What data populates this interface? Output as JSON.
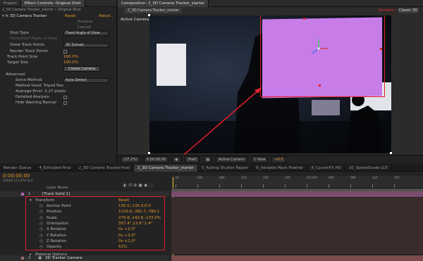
{
  "left_tabs": [
    "Project",
    "Effect Controls: Original Shot",
    "2_3D Camera Tracker_starter • Original Shot"
  ],
  "comp_tabs": [
    "Composition: 2_3D Camera Tracker_starter",
    "2_3D Camera Tracker_starter"
  ],
  "renderer": {
    "label": "Renderer:",
    "value": "Classic 3D"
  },
  "effect": {
    "name": "3D Camera Tracker",
    "reset": "Reset",
    "about": "About...",
    "analyze": "Analyze",
    "cancel": "Cancel",
    "shot_type_label": "Shot Type",
    "shot_type_value": "Fixed Angle of View",
    "hfov_label": "Horizontal Angle of View",
    "show_points_label": "Show Track Points",
    "show_points_value": "3D Solved",
    "render_points_label": "Render Track Points",
    "point_size_label": "Track Point Size",
    "point_size_value": "100.0%",
    "target_size_label": "Target Size",
    "target_size_value": "100.0%",
    "create_camera": "Create Camera",
    "advanced": "Advanced",
    "solve_method_label": "Solve Method",
    "solve_method_value": "Auto Detect",
    "method_used": "Method Used: Tripod Pan",
    "avg_error": "Average Error: 2.27 pixels",
    "detailed_analysis": "Detailed Analysis",
    "hide_warning": "Hide Warning Banner"
  },
  "viewer": {
    "label": "Active Camera",
    "zoom": "(37.2%)",
    "timecode": "0:00:00:00",
    "resolution": "(Half)",
    "camera": "Active Camera",
    "views": "1 View",
    "exposure": "+0.0"
  },
  "timeline_tabs": [
    "Render Queue",
    "4_Extruded-final",
    "2_3D Camera Tracker-final",
    "2_3D Camera Tracker_starter",
    "5_Rolling Shutter Repair",
    "6_Variable Mask Feather",
    "8_CycoreFX HD",
    "10_SpeedGrade LUT"
  ],
  "timeline": {
    "timecode": "0:00:00:00",
    "fps": "00000 (23.976 fps)",
    "layer_header": "Layer Name",
    "ruler": [
      "0f",
      "04f",
      "08f",
      "12f",
      "16f",
      "20f",
      "01:00f",
      "04f",
      "08f",
      "12f",
      "16f"
    ],
    "layers": [
      {
        "num": "1",
        "name": "[Track Solid 1]",
        "color": "#b46ab8"
      },
      {
        "num": "2",
        "name": "3D Tracker Camera",
        "color": "#a07070"
      }
    ],
    "transform": {
      "label": "Transform",
      "reset": "Reset",
      "props": [
        {
          "name": "Anchor Point",
          "value": "135.0,-135.0,0.0"
        },
        {
          "name": "Position",
          "value": "1239.6,-381.7,-780.1"
        },
        {
          "name": "Scale",
          "value": "279.6,-142.6,-133.0%"
        },
        {
          "name": "Orientation",
          "value": "357.4°,13.8°,1.4°"
        },
        {
          "name": "X Rotation",
          "value": "0x +2.0°"
        },
        {
          "name": "Y Rotation",
          "value": "0x +2.0°"
        },
        {
          "name": "Z Rotation",
          "value": "0x +2.0°"
        },
        {
          "name": "Opacity",
          "value": "51%"
        }
      ]
    },
    "material_options": "Material Options"
  },
  "colors": {
    "accent": "#e89a2c",
    "highlight_box": "#e0202a",
    "solid": "#c77ce8"
  }
}
